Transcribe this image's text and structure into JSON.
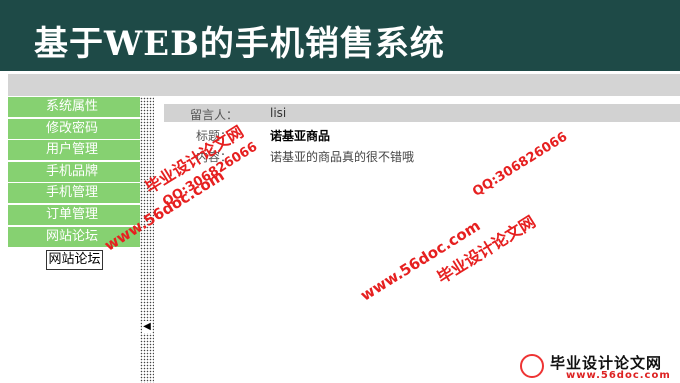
{
  "app": {
    "title": "基于WEB的手机销售系统"
  },
  "sidebar": {
    "items": [
      {
        "label": "系统属性"
      },
      {
        "label": "修改密码"
      },
      {
        "label": "用户管理"
      },
      {
        "label": "手机品牌"
      },
      {
        "label": "手机管理"
      },
      {
        "label": "订单管理"
      },
      {
        "label": "网站论坛"
      }
    ],
    "active_item": "网站论坛",
    "collapse_glyph": "◀"
  },
  "message": {
    "author_label": "留言人：",
    "author_value": "lisi",
    "title_label": "标题：",
    "title_value": "诺基亚商品",
    "content_label": "内容：",
    "content_value": "诺基亚的商品真的很不错哦"
  },
  "watermarks": {
    "site_name": "毕业设计论文网",
    "url": "www.56doc.com",
    "qq": "QQ:306826066",
    "footer_title": "毕业设计论文网",
    "footer_url": "www.56doc.com"
  },
  "colors": {
    "header_bg": "#1e4a47",
    "menu_bg": "#86d171",
    "watermark": "#e62020"
  }
}
